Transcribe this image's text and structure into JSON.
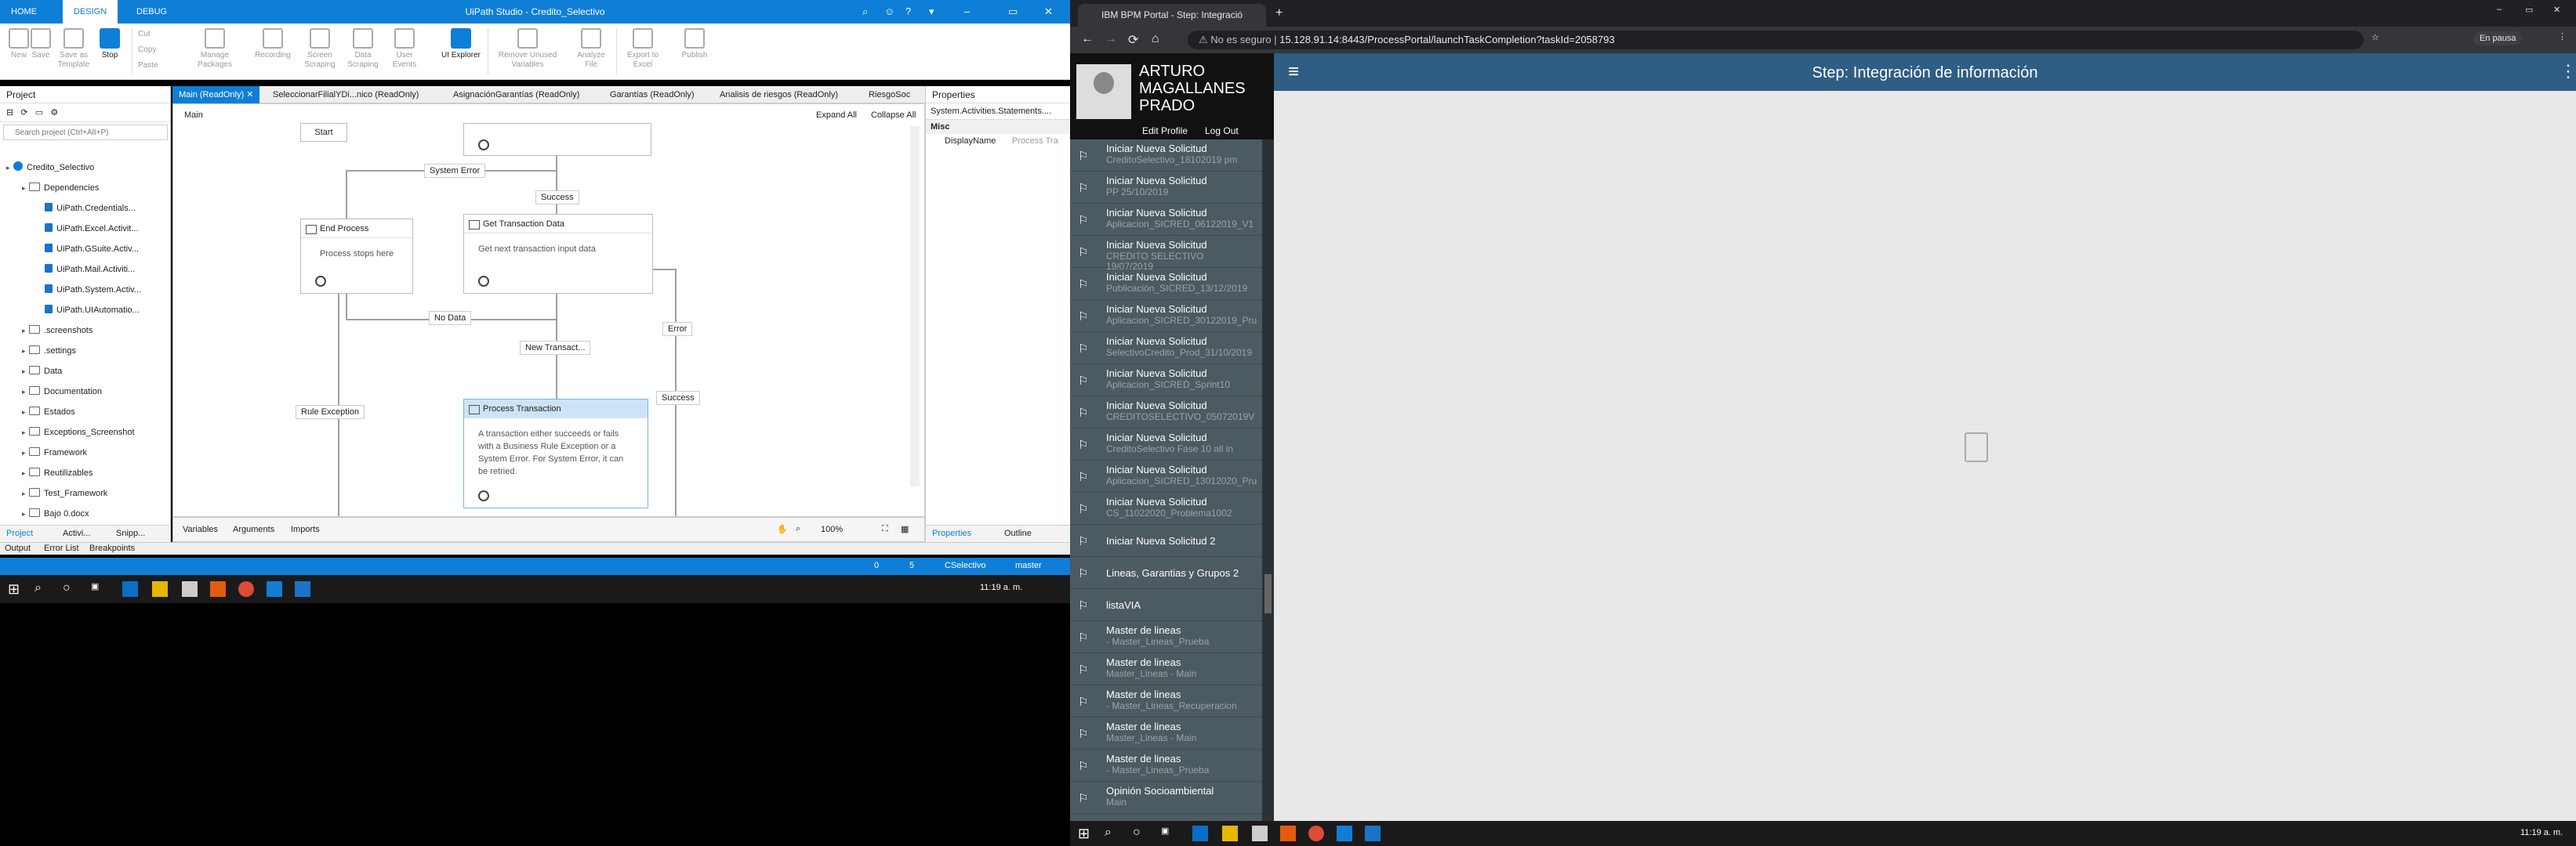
{
  "uipath": {
    "title": "UiPath Studio - Credito_Selectivo",
    "tabs": [
      "HOME",
      "DESIGN",
      "DEBUG"
    ],
    "ribbon": [
      "New",
      "Save",
      "Save as Template",
      "Stop",
      "Cut",
      "Copy",
      "Paste",
      "Manage Packages",
      "Recording",
      "Screen Scraping",
      "Data Scraping",
      "User Events",
      "UI Explorer",
      "Remove Unused Variables",
      "Analyze File",
      "Export to Excel",
      "Publish"
    ],
    "project_panel": {
      "title": "Project",
      "search": "Search project (Ctrl+Alt+P)",
      "tree": [
        {
          "label": "Credito_Selectivo",
          "level": 0,
          "kind": "project"
        },
        {
          "label": "Dependencies",
          "level": 1,
          "kind": "folder"
        },
        {
          "label": "UiPath.Credentials...",
          "level": 2,
          "kind": "pkg"
        },
        {
          "label": "UiPath.Excel.Activit...",
          "level": 2,
          "kind": "pkg"
        },
        {
          "label": "UiPath.GSuite.Activ...",
          "level": 2,
          "kind": "pkg"
        },
        {
          "label": "UiPath.Mail.Activiti...",
          "level": 2,
          "kind": "pkg"
        },
        {
          "label": "UiPath.System.Activ...",
          "level": 2,
          "kind": "pkg"
        },
        {
          "label": "UiPath.UIAutomatio...",
          "level": 2,
          "kind": "pkg"
        },
        {
          "label": ".screenshots",
          "level": 1,
          "kind": "folder"
        },
        {
          "label": ".settings",
          "level": 1,
          "kind": "folder"
        },
        {
          "label": "Data",
          "level": 1,
          "kind": "folder"
        },
        {
          "label": "Documentation",
          "level": 1,
          "kind": "folder"
        },
        {
          "label": "Estados",
          "level": 1,
          "kind": "folder"
        },
        {
          "label": "Exceptions_Screenshot",
          "level": 1,
          "kind": "folder"
        },
        {
          "label": "Framework",
          "level": 1,
          "kind": "folder"
        },
        {
          "label": "Reutilizables",
          "level": 1,
          "kind": "folder"
        },
        {
          "label": "Test_Framework",
          "level": 1,
          "kind": "folder"
        },
        {
          "label": "Bajo 0.docx",
          "level": 1,
          "kind": "file"
        }
      ],
      "bottom_tabs": [
        "Project",
        "Activi...",
        "Snipp..."
      ]
    },
    "doc_tabs": [
      "Main (ReadOnly)",
      "SeleccionarFilialYDi...nico (ReadOnly)",
      "AsignaciónGarantías (ReadOnly)",
      "Garantías (ReadOnly)",
      "Analisis de riesgos (ReadOnly)",
      "RiesgoSoc"
    ],
    "canvas": {
      "breadcrumb": "Main",
      "expand_all": "Expand All",
      "collapse_all": "Collapse All",
      "start": "Start",
      "end_process": {
        "title": "End Process",
        "body": "Process stops here"
      },
      "get_transaction": {
        "title": "Get Transaction Data",
        "body": "Get next transaction input data"
      },
      "process_transaction": {
        "title": "Process Transaction",
        "body": "A transaction either succeeds or fails with a Business Rule Exception or a System Error. For System Error, it can be retried."
      },
      "labels": {
        "system_error": "System Error",
        "success1": "Success",
        "no_data": "No Data",
        "new_transact": "New Transact...",
        "error": "Error",
        "success2": "Success",
        "rule_exception": "Rule Exception"
      },
      "bottom": [
        "Variables",
        "Arguments",
        "Imports"
      ],
      "zoom": "100%"
    },
    "properties": {
      "title": "Properties",
      "type": "System.Activities.Statements....",
      "category": "Misc",
      "row_label": "DisplayName",
      "row_value": "Process Tra",
      "tabs": [
        "Properties",
        "Outline"
      ]
    },
    "output_tabs": [
      "Output",
      "Error List",
      "Breakpoints"
    ],
    "status": {
      "a": "0",
      "b": "5",
      "project": "CSelectivo",
      "branch": "master"
    }
  },
  "taskbar": {
    "time": "11:19 a. m."
  },
  "chrome": {
    "tab_title": "IBM BPM Portal - Step: Integració",
    "not_secure": "No es seguro",
    "url": "15.128.91.14:8443/ProcessPortal/launchTaskCompletion?taskId=2058793",
    "paused": "En pausa"
  },
  "bpm": {
    "user_name": [
      "ARTURO",
      "MAGALLANES",
      "PRADO"
    ],
    "edit_profile": "Edit Profile",
    "log_out": "Log Out",
    "header": "Step: Integración de información",
    "items": [
      {
        "t1": "Iniciar Nueva Solicitud",
        "t2": "CreditoSelectivo_18102019 pm"
      },
      {
        "t1": "Iniciar Nueva Solicitud",
        "t2": "PP 25/10/2019"
      },
      {
        "t1": "Iniciar Nueva Solicitud",
        "t2": "Aplicacion_SICRED_06122019_V1"
      },
      {
        "t1": "Iniciar Nueva Solicitud",
        "t2": "CREDITO SELECTIVO",
        "t3": "19/07/2019"
      },
      {
        "t1": "Iniciar Nueva Solicitud",
        "t2": "Publicación_SICRED_13/12/2019"
      },
      {
        "t1": "Iniciar Nueva Solicitud",
        "t2": "Aplicacion_SICRED_30122019_Pru"
      },
      {
        "t1": "Iniciar Nueva Solicitud",
        "t2": "SelectivoCredito_Prod_31/10/2019"
      },
      {
        "t1": "Iniciar Nueva Solicitud",
        "t2": "Aplicacion_SICRED_Sprint10"
      },
      {
        "t1": "Iniciar Nueva Solicitud",
        "t2": "CREDITOSELECTIVO_05072019V"
      },
      {
        "t1": "Iniciar Nueva Solicitud",
        "t2": "CreditoSelectivo Fase 10 all in"
      },
      {
        "t1": "Iniciar Nueva Solicitud",
        "t2": "Aplicacion_SICRED_13012020_Pru"
      },
      {
        "t1": "Iniciar Nueva Solicitud",
        "t2": "CS_11022020_Problema1002"
      },
      {
        "t1": "Iniciar Nueva Solicitud 2"
      },
      {
        "t1": "Lineas, Garantias y Grupos 2"
      },
      {
        "t1": "listaVIA"
      },
      {
        "t1": "Master de lineas",
        "t2": "- Master_Lineas_Prueba"
      },
      {
        "t1": "Master de lineas",
        "t2": "Master_Lineas - Main"
      },
      {
        "t1": "Master de lineas",
        "t2": "- Master_Lineas_Recuperacion"
      },
      {
        "t1": "Master de lineas",
        "t2": "Master_Lineas - Main"
      },
      {
        "t1": "Master de lineas",
        "t2": "- Master_Lineas_Prueba"
      },
      {
        "t1": "Opinión Socioambiental",
        "t2": "Main"
      }
    ]
  }
}
